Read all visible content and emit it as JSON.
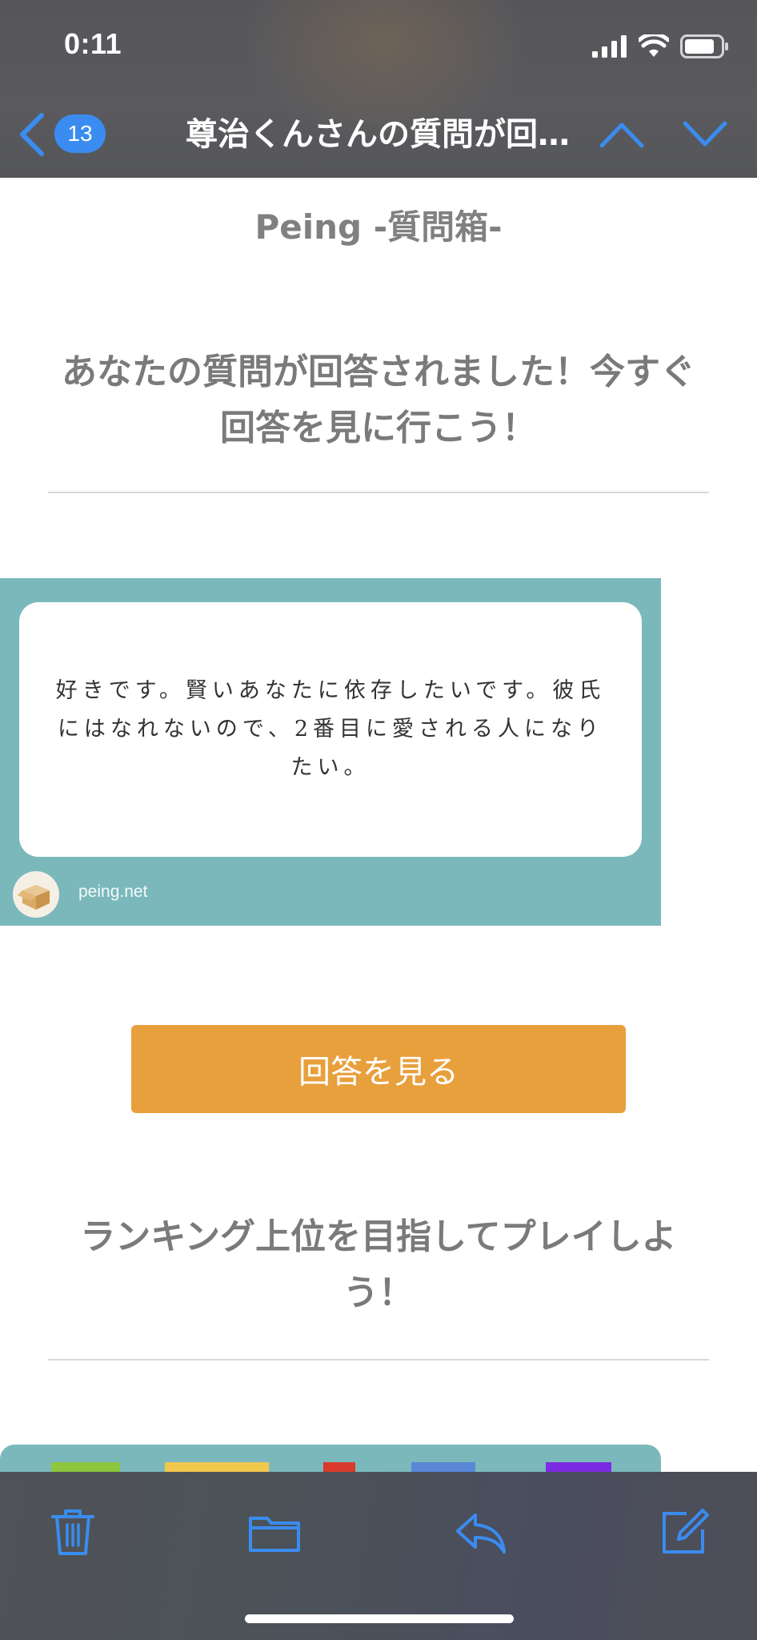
{
  "status_bar": {
    "time": "0:11"
  },
  "nav": {
    "unread_count": "13",
    "title": "尊治くんさんの質問が回…"
  },
  "email": {
    "brand": "Peing -質問箱-",
    "headline": "あなたの質問が回答されました！今すぐ回答を見に行こう！",
    "question_card": {
      "text": "好きです。賢いあなたに依存したいです。彼氏にはなれないので、2番目に愛される人になりたい。",
      "site": "peing.net"
    },
    "cta_label": "回答を見る",
    "headline2": "ランキング上位を目指してプレイしよう！"
  },
  "toolbar": {
    "icons": [
      "trash-icon",
      "folder-icon",
      "reply-icon",
      "compose-icon"
    ]
  },
  "colors": {
    "accent_blue": "#3a8cf0",
    "card_teal": "#7bb8bc",
    "cta_orange": "#e8a03c"
  }
}
